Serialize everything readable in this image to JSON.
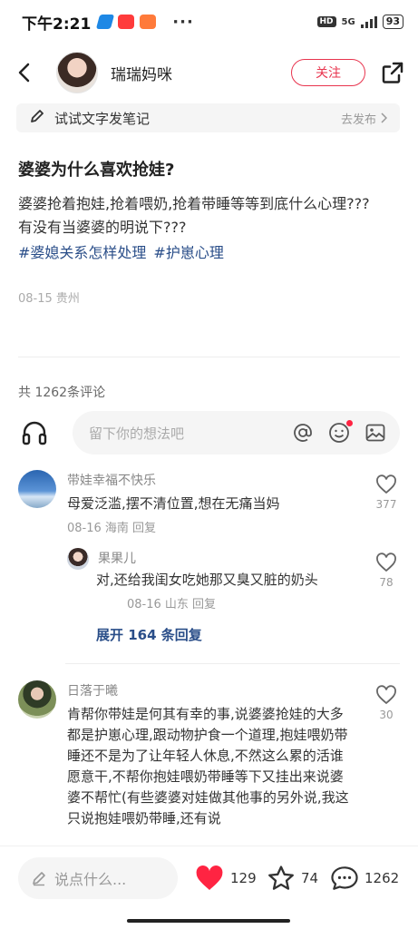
{
  "status_bar": {
    "time": "下午2:21",
    "more": "···",
    "hd": "HD",
    "network": "5G",
    "battery": "93"
  },
  "header": {
    "author_name": "瑞瑞妈咪",
    "follow_label": "关注"
  },
  "draft": {
    "text": "试试文字发笔记",
    "action": "去发布"
  },
  "post": {
    "title": "婆婆为什么喜欢抢娃?",
    "body_line1": "婆婆抢着抱娃,抢着喂奶,抢着带睡等等到底什么心理???",
    "body_line2": "有没有当婆婆的明说下???",
    "tags": [
      "#婆媳关系怎样处理",
      "#护崽心理"
    ],
    "meta": "08-15 贵州"
  },
  "comments_section": {
    "count_label": "共 1262条评论",
    "input_placeholder": "留下你的想法吧"
  },
  "comments": [
    {
      "name": "带娃幸福不快乐",
      "text": "母爱泛滥,摆不清位置,想在无痛当妈",
      "meta": "08-16 海南 回复",
      "likes": "377"
    },
    {
      "name": "果果儿",
      "text": "对,还给我闺女吃她那又臭又脏的奶头",
      "meta": "08-16 山东 回复",
      "likes": "78"
    },
    {
      "name": "日落于曦",
      "text": "肯帮你带娃是何其有幸的事,说婆婆抢娃的大多都是护崽心理,跟动物护食一个道理,抱娃喂奶带睡还不是为了让年轻人休息,不然这么累的活谁愿意干,不帮你抱娃喂奶带睡等下又挂出来说婆婆不帮忙(有些婆婆对娃做其他事的另外说,我这只说抱娃喂奶带睡,还有说",
      "likes": "30"
    }
  ],
  "expand_replies": "展开 164 条回复",
  "bottom_bar": {
    "say_placeholder": "说点什么...",
    "likes": "129",
    "collects": "74",
    "comments": "1262"
  },
  "colors": {
    "brand_red": "#e8344e",
    "tag_blue": "#2a4e89",
    "heart_red": "#ff2442"
  }
}
